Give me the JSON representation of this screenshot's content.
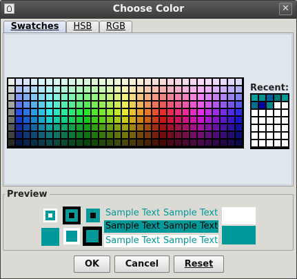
{
  "window": {
    "title": "Choose Color",
    "close_symbol": "✕"
  },
  "tabs": [
    {
      "label": "Swatches",
      "active": true
    },
    {
      "label": "HSB",
      "active": false
    },
    {
      "label": "RGB",
      "active": false
    }
  ],
  "recent": {
    "label": "Recent:",
    "colors": [
      "#00a0a0",
      "#009090",
      "#0060a0",
      "#007878",
      "#009999",
      "#006e8e",
      "#0000a0",
      "#008888"
    ]
  },
  "preview": {
    "label": "Preview",
    "sample_text": "Sample Text",
    "color": "#009999"
  },
  "buttons": {
    "ok": "OK",
    "cancel": "Cancel",
    "reset": "Reset"
  },
  "colors": {
    "accent": "#009999",
    "selection_bg": "#009999",
    "window_bg": "#dcdad5"
  }
}
